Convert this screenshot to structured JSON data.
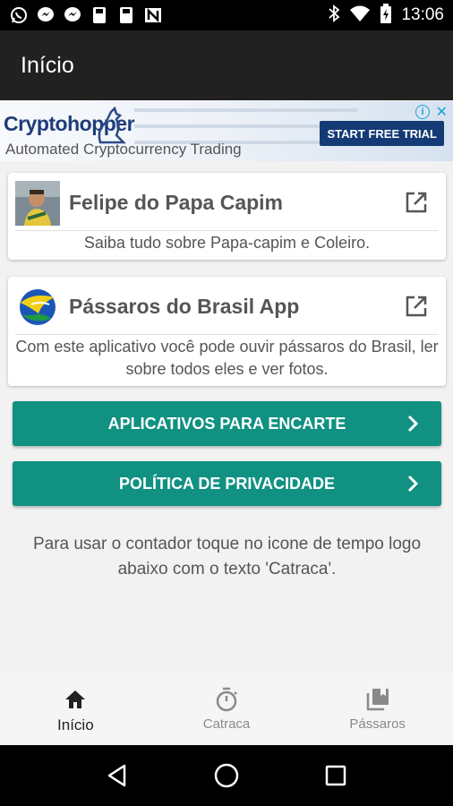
{
  "status_bar": {
    "time": "13:06",
    "left_icons": [
      "whatsapp-icon",
      "messenger-icon",
      "messenger-icon",
      "save-icon",
      "save-icon",
      "n-icon"
    ],
    "right_icons": [
      "bluetooth-icon",
      "wifi-icon",
      "battery-icon"
    ]
  },
  "app_bar": {
    "title": "Início"
  },
  "ad": {
    "brand": "Cryptohopper",
    "tagline": "Automated Cryptocurrency Trading",
    "cta": "START FREE TRIAL",
    "info_glyph": "i",
    "close_glyph": "✕"
  },
  "cards": [
    {
      "title": "Felipe do Papa Capim",
      "description": "Saiba tudo sobre Papa-capim e Coleiro."
    },
    {
      "title": "Pássaros do Brasil App",
      "description": "Com este aplicativo você pode ouvir pássaros do Brasil, ler sobre todos eles e ver fotos."
    }
  ],
  "buttons": {
    "apps": "APLICATIVOS PARA ENCARTE",
    "privacy": "POLÍTICA DE PRIVACIDADE"
  },
  "hint": "Para usar o contador toque no icone de tempo logo abaixo com o texto 'Catraca'.",
  "bottom_nav": [
    {
      "label": "Início",
      "icon": "home-icon",
      "active": true
    },
    {
      "label": "Catraca",
      "icon": "timer-icon",
      "active": false
    },
    {
      "label": "Pássaros",
      "icon": "library-icon",
      "active": false
    }
  ],
  "colors": {
    "accent": "#109182",
    "app_bar": "#212121",
    "background": "#f2f2f2"
  }
}
